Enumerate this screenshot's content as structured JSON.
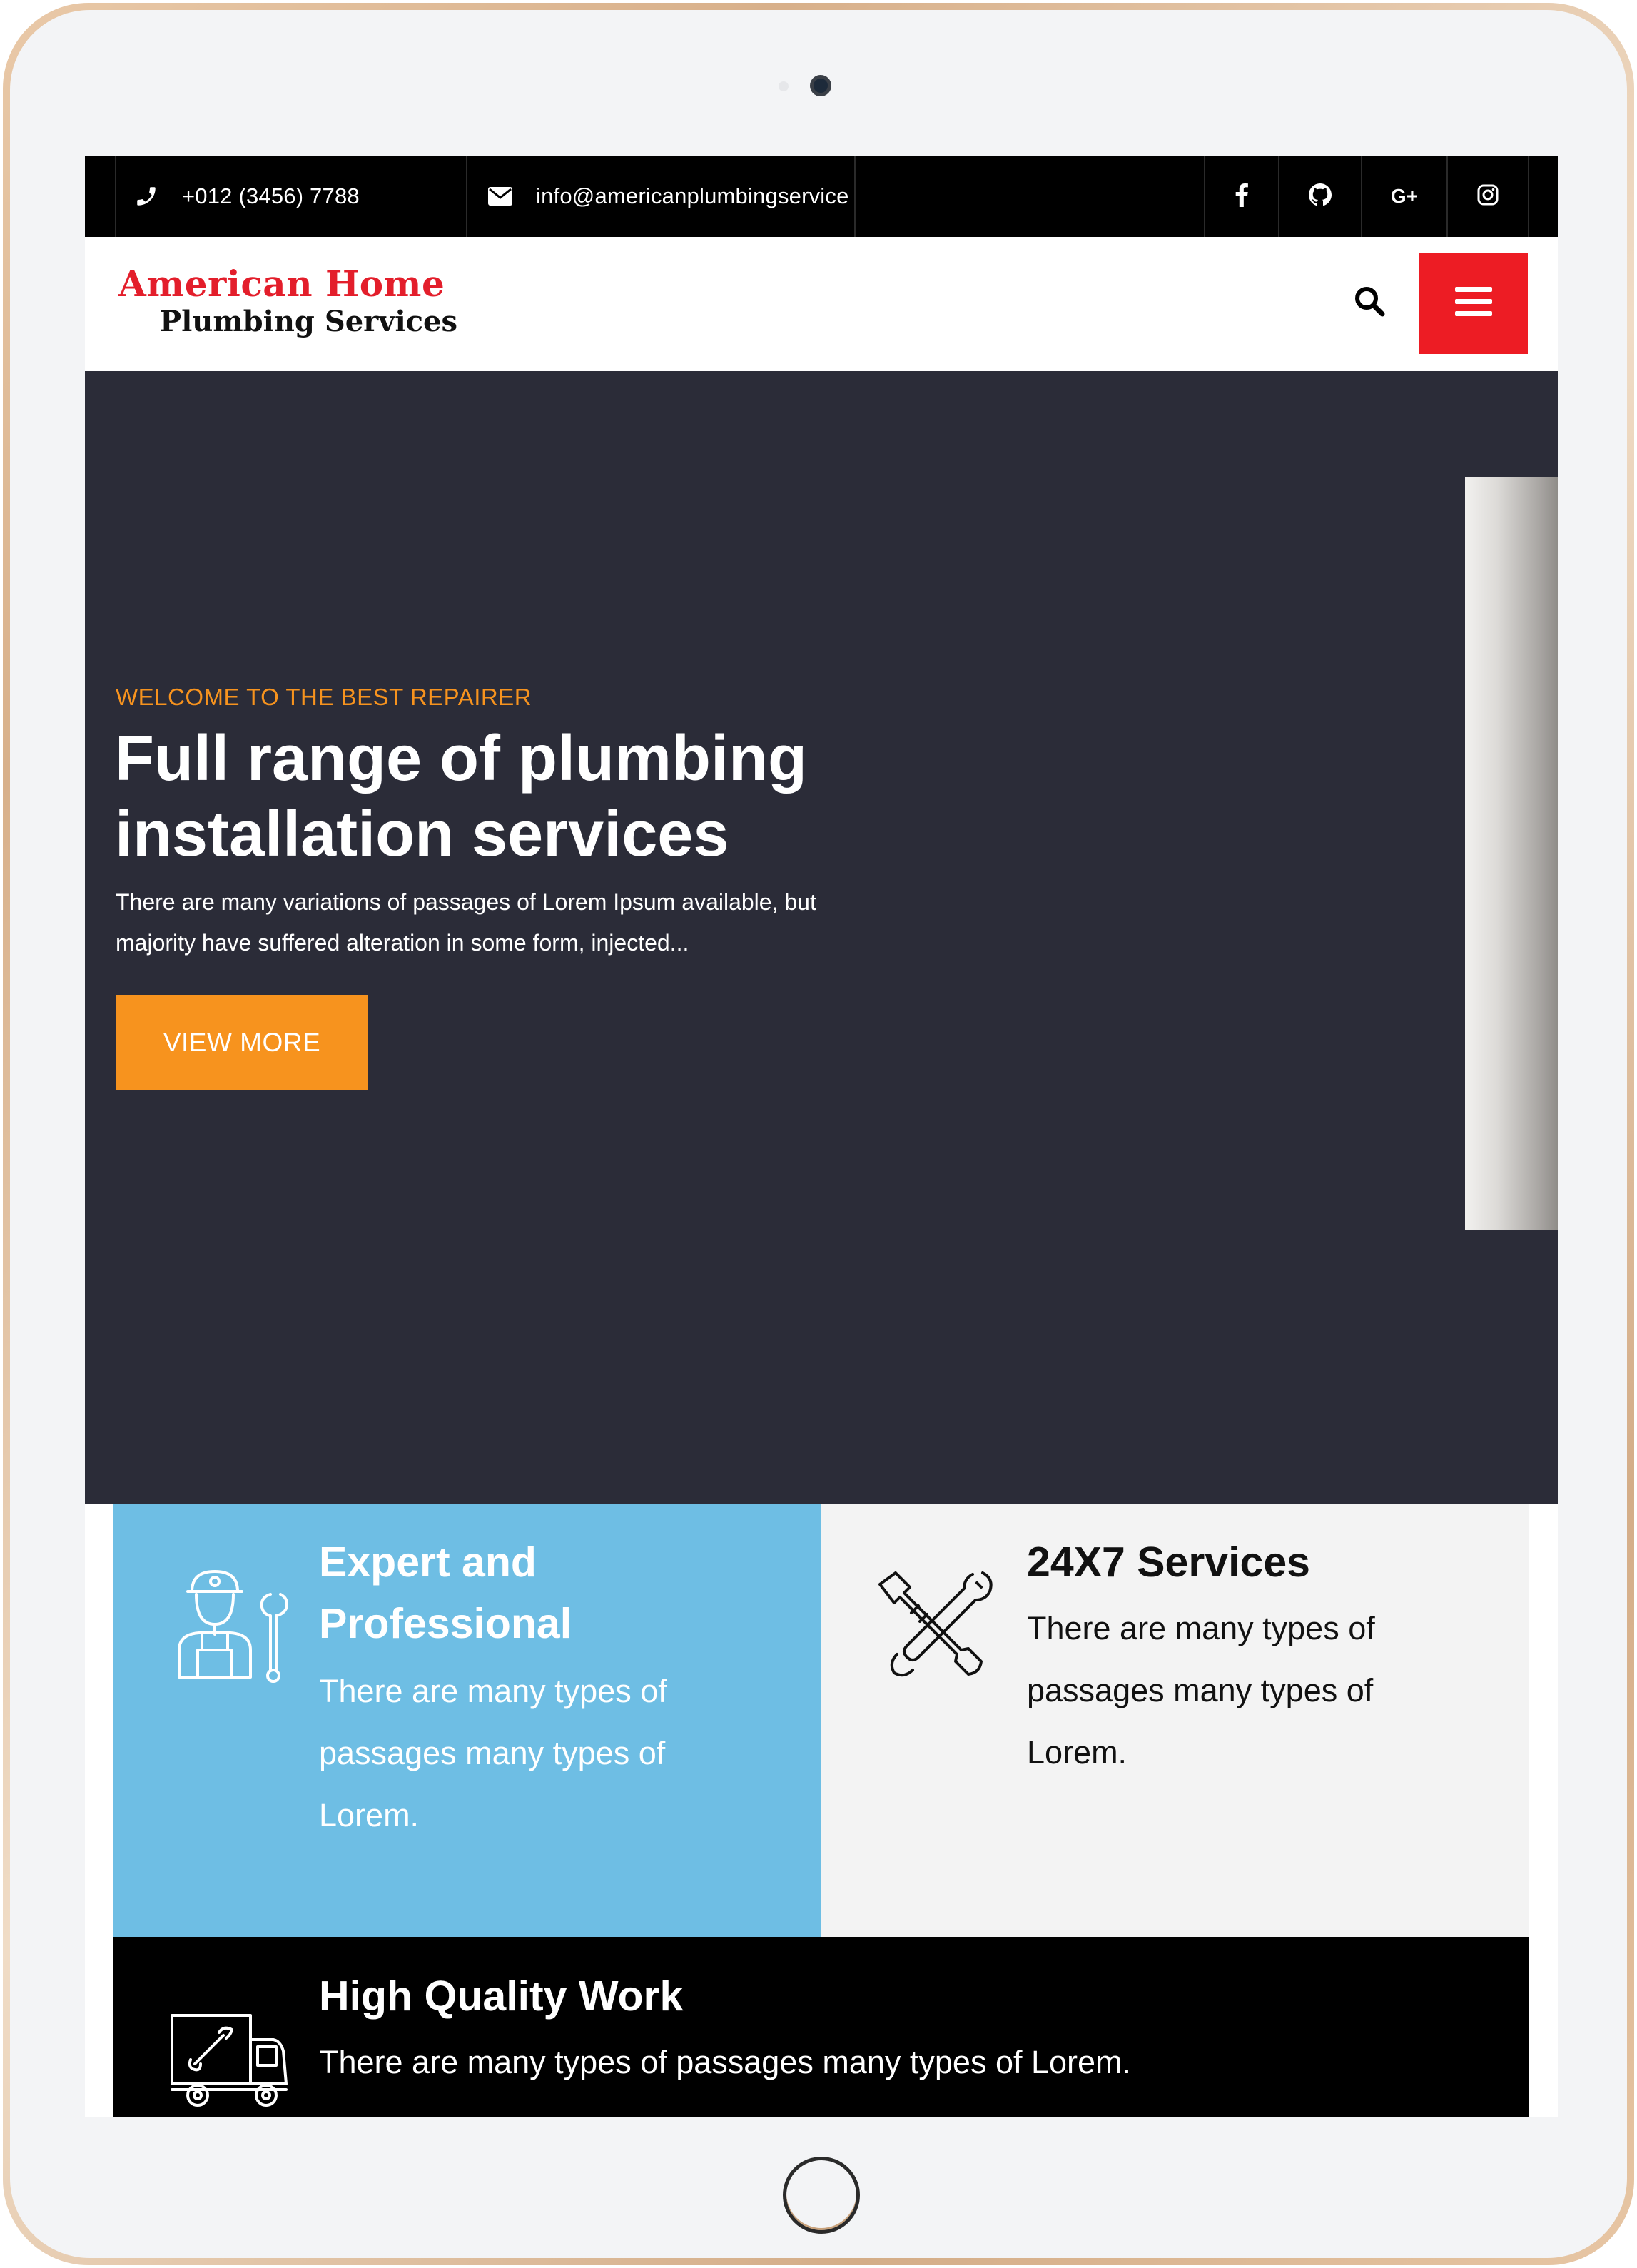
{
  "topbar": {
    "phone": "+012 (3456) 7788",
    "email": "info@americanplumbingservice",
    "social_icons": [
      "facebook-icon",
      "github-icon",
      "google-plus-icon",
      "instagram-icon"
    ],
    "google_plus_label": "G+"
  },
  "header": {
    "logo_line1": "American Home",
    "logo_line2": "Plumbing Services"
  },
  "hero": {
    "kicker": "WELCOME TO THE BEST REPAIRER",
    "title": "Full range of plumbing installation services",
    "text": "There are many variations of passages of Lorem Ipsum available, but majority have suffered alteration in some form, injected...",
    "button": "VIEW MORE"
  },
  "features": [
    {
      "title": "Expert and Professional",
      "text": "There are many types of passages many types of Lorem.",
      "icon": "plumber-worker-icon"
    },
    {
      "title": "24X7 Services",
      "text": "There are many types of passages many types of Lorem.",
      "icon": "crossed-tools-icon"
    },
    {
      "title": "High Quality Work",
      "text": "There are many types of passages many types of Lorem.",
      "icon": "service-truck-icon"
    }
  ],
  "colors": {
    "accent_red": "#ed1c24",
    "accent_orange": "#f7931e",
    "hero_bg": "#2b2c38",
    "feature_blue": "#6ebee4",
    "topbar_bg": "#000000"
  }
}
